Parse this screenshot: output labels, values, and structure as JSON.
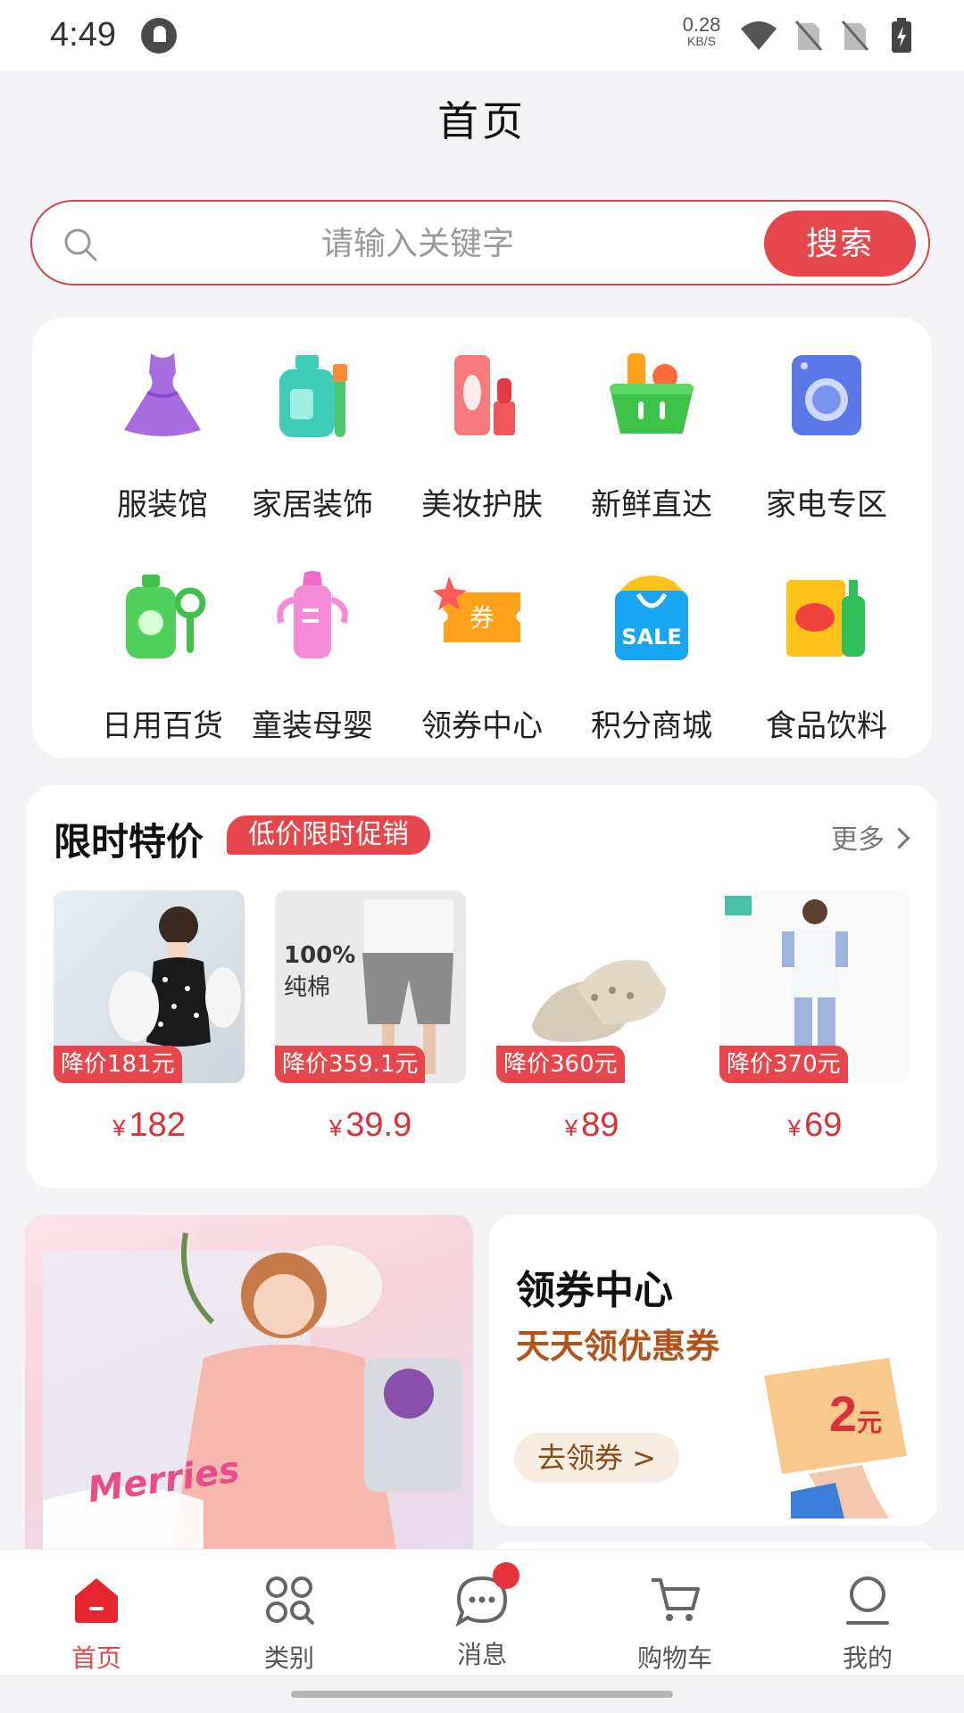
{
  "status_bar": {
    "time": "4:49",
    "net_speed": "0.28",
    "net_unit": "KB/S"
  },
  "header": {
    "title": "首页"
  },
  "search": {
    "placeholder": "请输入关键字",
    "button_label": "搜索"
  },
  "categories": [
    {
      "label": "服装馆",
      "icon": "dress-icon",
      "color": "#a96be0"
    },
    {
      "label": "家居装饰",
      "icon": "detergent-icon",
      "color": "#3fcdb8"
    },
    {
      "label": "美妆护肤",
      "icon": "cosmetics-icon",
      "color": "#f0565a"
    },
    {
      "label": "新鲜直达",
      "icon": "fresh-basket-icon",
      "color": "#3fc24a"
    },
    {
      "label": "家电专区",
      "icon": "washing-machine-icon",
      "color": "#5b78e8"
    },
    {
      "label": "日用百货",
      "icon": "daily-goods-icon",
      "color": "#3fc24a"
    },
    {
      "label": "童装母婴",
      "icon": "baby-bottle-icon",
      "color": "#f06cc8"
    },
    {
      "label": "领券中心",
      "icon": "coupon-icon",
      "color": "#ffa11a"
    },
    {
      "label": "积分商城",
      "icon": "sale-bag-icon",
      "color": "#19a6f0"
    },
    {
      "label": "食品饮料",
      "icon": "snack-drink-icon",
      "color": "#ffc21a"
    }
  ],
  "flash_sale": {
    "title": "限时特价",
    "badge": "低价限时促销",
    "more_label": "更多",
    "products": [
      {
        "tag": "降价181元",
        "currency": "¥",
        "price": "182",
        "image": "dress-photo"
      },
      {
        "tag": "降价359.1元",
        "currency": "¥",
        "price": "39.9",
        "image": "shorts-photo",
        "overlay_text": "100%",
        "overlay_sub": "纯棉"
      },
      {
        "tag": "降价360元",
        "currency": "¥",
        "price": "89",
        "image": "sandals-photo"
      },
      {
        "tag": "降价370元",
        "currency": "¥",
        "price": "69",
        "image": "nurse-uniform-photo"
      }
    ]
  },
  "promo_banner": {
    "label": "Merries"
  },
  "coupon_center": {
    "title": "领券中心",
    "subtitle": "天天领优惠券",
    "button": "去领券 >",
    "ticket_amount": "2",
    "ticket_unit": "元"
  },
  "tab_bar": [
    {
      "label": "首页",
      "icon": "home-icon",
      "active": true
    },
    {
      "label": "类别",
      "icon": "category-grid-icon",
      "active": false
    },
    {
      "label": "消息",
      "icon": "message-icon",
      "active": false,
      "badge": true
    },
    {
      "label": "购物车",
      "icon": "cart-icon",
      "active": false
    },
    {
      "label": "我的",
      "icon": "profile-icon",
      "active": false
    }
  ],
  "colors": {
    "accent": "#e6474c",
    "price": "#d9303a",
    "background": "#f3f3f5"
  }
}
